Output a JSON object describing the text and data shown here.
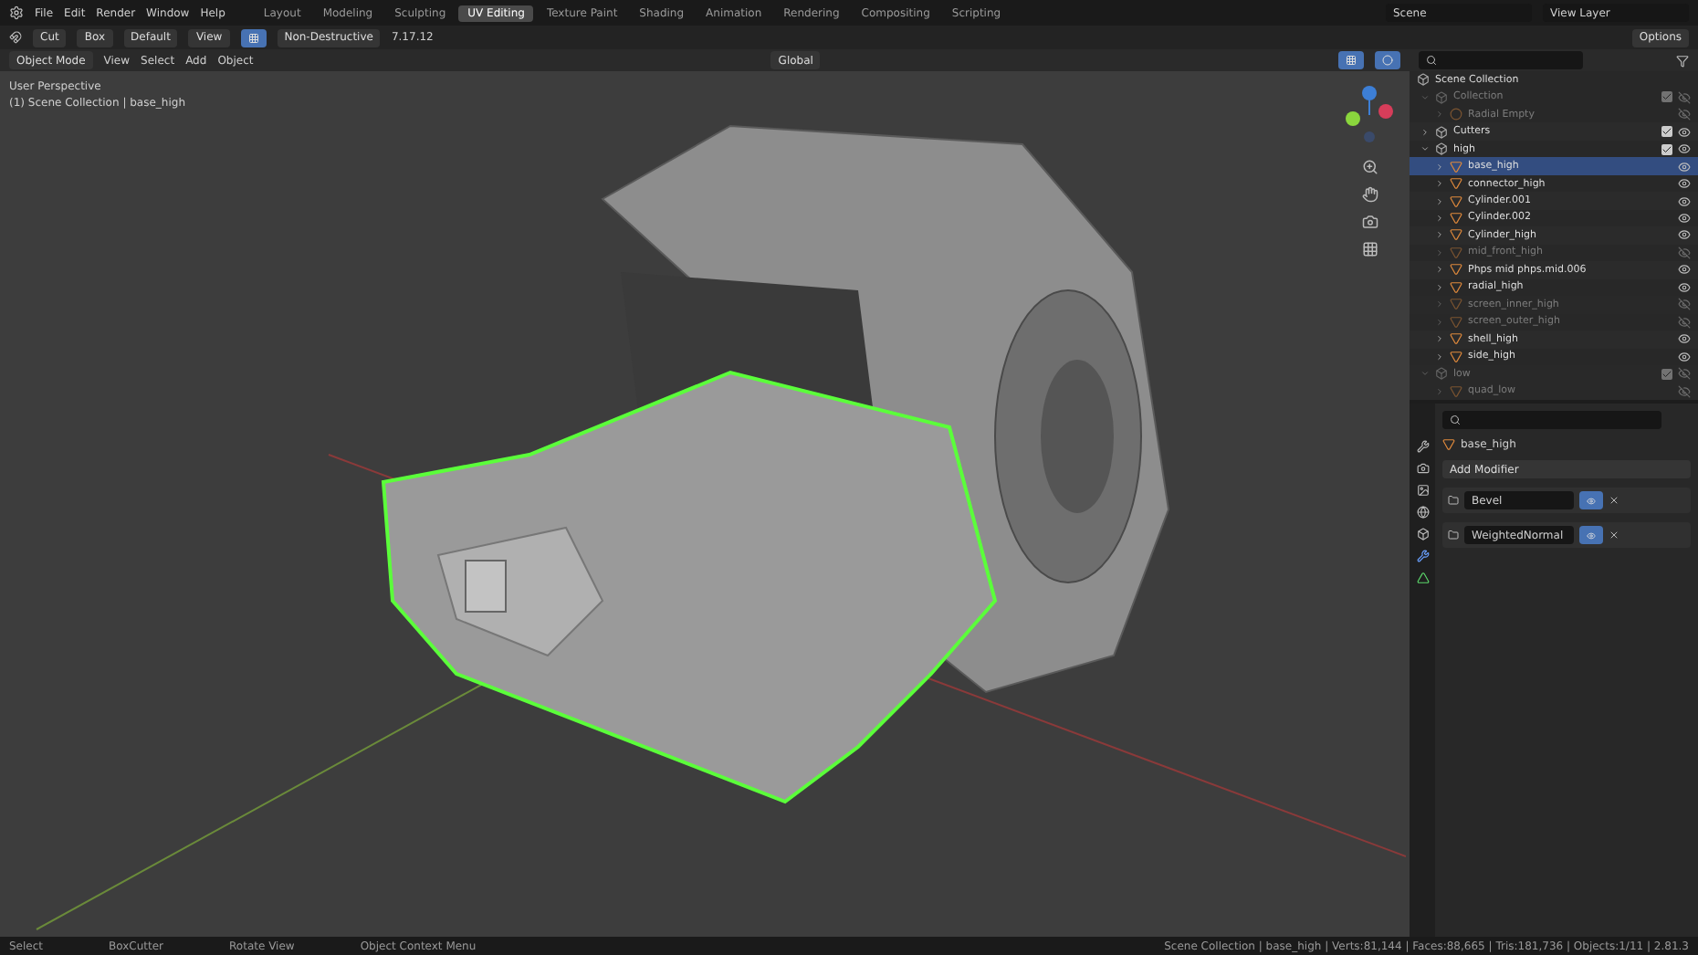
{
  "menu": [
    "File",
    "Edit",
    "Render",
    "Window",
    "Help"
  ],
  "workspaces": [
    {
      "label": "Layout",
      "selected": false
    },
    {
      "label": "Modeling",
      "selected": false
    },
    {
      "label": "Sculpting",
      "selected": false
    },
    {
      "label": "UV Editing",
      "selected": true
    },
    {
      "label": "Texture Paint",
      "selected": false
    },
    {
      "label": "Shading",
      "selected": false
    },
    {
      "label": "Animation",
      "selected": false
    },
    {
      "label": "Rendering",
      "selected": false
    },
    {
      "label": "Compositing",
      "selected": false
    },
    {
      "label": "Scripting",
      "selected": false
    }
  ],
  "scene": "Scene",
  "view_layer": "View Layer",
  "tool_header": {
    "cut": "Cut",
    "shape": "Box",
    "pivot": "Default",
    "view": "View",
    "mode": "Non-Destructive",
    "value": "7.17.12",
    "options": "Options"
  },
  "viewport_header": {
    "mode": "Object Mode",
    "menus": [
      "View",
      "Select",
      "Add",
      "Object"
    ],
    "orientation": "Global"
  },
  "viewport": {
    "perspective": "User Perspective",
    "context": "(1) Scene Collection | base_high"
  },
  "outliner": {
    "root": "Scene Collection",
    "items": [
      {
        "name": "Collection",
        "kind": "collection",
        "disabled": true,
        "selected": false,
        "checked": true,
        "children": [
          {
            "name": "Radial Empty",
            "kind": "empty",
            "disabled": true,
            "selected": false
          }
        ]
      },
      {
        "name": "Cutters",
        "kind": "collection",
        "disabled": false,
        "selected": false,
        "checked": true
      },
      {
        "name": "high",
        "kind": "collection",
        "disabled": false,
        "selected": false,
        "checked": true,
        "children": [
          {
            "name": "base_high",
            "kind": "mesh",
            "disabled": false,
            "selected": true
          },
          {
            "name": "connector_high",
            "kind": "mesh",
            "disabled": false,
            "selected": false
          },
          {
            "name": "Cylinder.001",
            "kind": "mesh",
            "disabled": false,
            "selected": false
          },
          {
            "name": "Cylinder.002",
            "kind": "mesh",
            "disabled": false,
            "selected": false
          },
          {
            "name": "Cylinder_high",
            "kind": "mesh",
            "disabled": false,
            "selected": false
          },
          {
            "name": "mid_front_high",
            "kind": "mesh",
            "disabled": true,
            "selected": false
          },
          {
            "name": "Phps mid phps.mid.006",
            "kind": "mesh",
            "disabled": false,
            "selected": false
          },
          {
            "name": "radial_high",
            "kind": "mesh",
            "disabled": false,
            "selected": false
          },
          {
            "name": "screen_inner_high",
            "kind": "mesh",
            "disabled": true,
            "selected": false
          },
          {
            "name": "screen_outer_high",
            "kind": "mesh",
            "disabled": true,
            "selected": false
          },
          {
            "name": "shell_high",
            "kind": "mesh",
            "disabled": false,
            "selected": false
          },
          {
            "name": "side_high",
            "kind": "mesh",
            "disabled": false,
            "selected": false
          }
        ]
      },
      {
        "name": "low",
        "kind": "collection",
        "disabled": true,
        "selected": false,
        "checked": true,
        "children": [
          {
            "name": "quad_low",
            "kind": "mesh",
            "disabled": true,
            "selected": false
          }
        ]
      }
    ]
  },
  "properties": {
    "object": "base_high",
    "add_modifier": "Add Modifier",
    "modifiers": [
      "Bevel",
      "WeightedNormal"
    ]
  },
  "status_bar": {
    "hints": [
      "Select",
      "BoxCutter",
      "Rotate View",
      "Object Context Menu"
    ],
    "stats": "Scene Collection | base_high | Verts:81,144 | Faces:88,665 | Tris:181,736 | Objects:1/11 | 2.81.3"
  }
}
